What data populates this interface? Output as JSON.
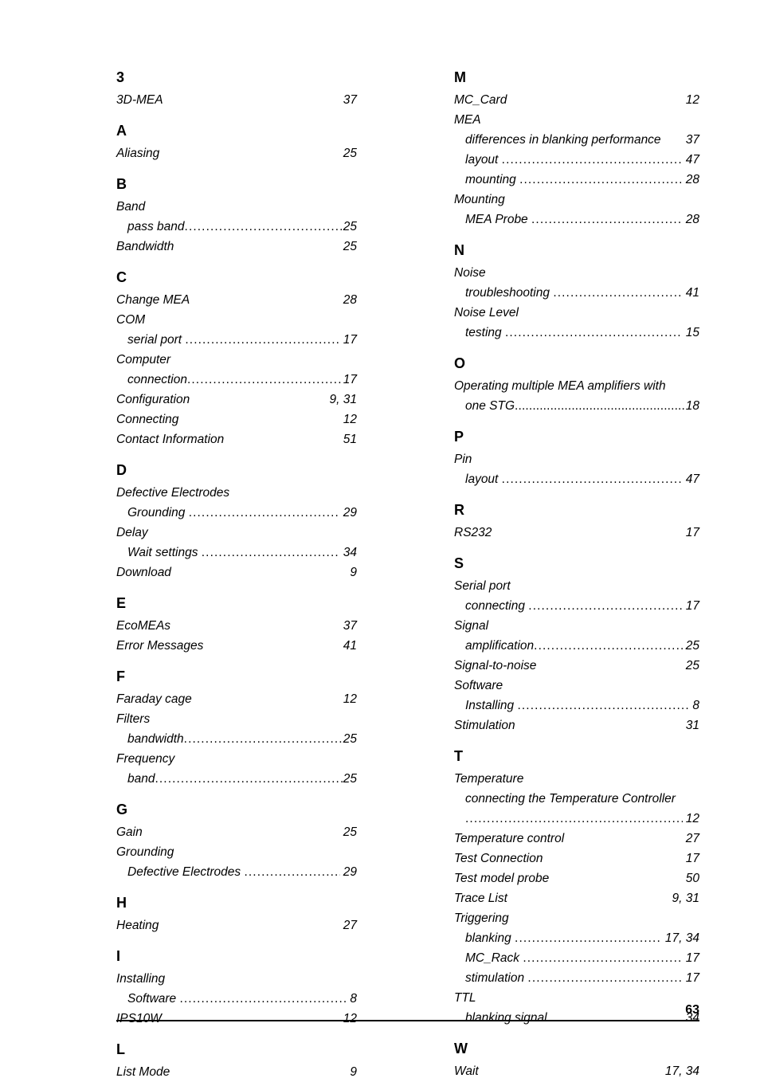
{
  "document": {
    "footer_page_number": "63"
  },
  "index": {
    "left_column": [
      {
        "letter": "3",
        "entries": [
          {
            "kind": "entry",
            "label": "3D-MEA",
            "page": "37"
          }
        ]
      },
      {
        "letter": "A",
        "entries": [
          {
            "kind": "entry",
            "label": "Aliasing",
            "page": "25"
          }
        ]
      },
      {
        "letter": "B",
        "entries": [
          {
            "kind": "term",
            "label": "Band"
          },
          {
            "kind": "subentry",
            "label": "pass band",
            "page": "25",
            "leader": "normal",
            "gap": false
          },
          {
            "kind": "entry",
            "label": "Bandwidth",
            "page": "25"
          }
        ]
      },
      {
        "letter": "C",
        "entries": [
          {
            "kind": "entry",
            "label": "Change MEA",
            "page": "28"
          },
          {
            "kind": "term",
            "label": "COM"
          },
          {
            "kind": "subentry",
            "label": "serial port",
            "page": "17",
            "leader": "normal",
            "gap": true
          },
          {
            "kind": "term",
            "label": "Computer"
          },
          {
            "kind": "subentry",
            "label": "connection",
            "page": "17",
            "leader": "normal",
            "gap": false
          },
          {
            "kind": "entry",
            "label": "Configuration",
            "page": "9, 31"
          },
          {
            "kind": "entry",
            "label": "Connecting",
            "page": "12"
          },
          {
            "kind": "entry",
            "label": "Contact Information",
            "page": "51"
          }
        ]
      },
      {
        "letter": "D",
        "entries": [
          {
            "kind": "term",
            "label": "Defective Electrodes"
          },
          {
            "kind": "subentry",
            "label": "Grounding",
            "page": "29",
            "leader": "normal",
            "gap": true
          },
          {
            "kind": "term",
            "label": "Delay"
          },
          {
            "kind": "subentry",
            "label": "Wait settings",
            "page": "34",
            "leader": "normal",
            "gap": true
          },
          {
            "kind": "entry",
            "label": "Download",
            "page": "9"
          }
        ]
      },
      {
        "letter": "E",
        "entries": [
          {
            "kind": "entry",
            "label": "EcoMEAs",
            "page": "37"
          },
          {
            "kind": "entry",
            "label": "Error Messages",
            "page": "41"
          }
        ]
      },
      {
        "letter": "F",
        "entries": [
          {
            "kind": "entry",
            "label": "Faraday cage",
            "page": "12"
          },
          {
            "kind": "term",
            "label": "Filters"
          },
          {
            "kind": "subentry",
            "label": "bandwidth",
            "page": "25",
            "leader": "normal",
            "gap": false
          },
          {
            "kind": "term",
            "label": "Frequency"
          },
          {
            "kind": "subentry",
            "label": "band",
            "page": "25",
            "leader": "normal",
            "gap": false
          }
        ]
      },
      {
        "letter": "G",
        "entries": [
          {
            "kind": "entry",
            "label": "Gain",
            "page": "25"
          },
          {
            "kind": "term",
            "label": "Grounding"
          },
          {
            "kind": "subentry",
            "label": "Defective Electrodes",
            "page": "29",
            "leader": "normal",
            "gap": true
          }
        ]
      },
      {
        "letter": "H",
        "entries": [
          {
            "kind": "entry",
            "label": "Heating",
            "page": "27"
          }
        ]
      },
      {
        "letter": "I",
        "entries": [
          {
            "kind": "term",
            "label": "Installing"
          },
          {
            "kind": "subentry",
            "label": "Software",
            "page": "8",
            "leader": "normal",
            "gap": true
          },
          {
            "kind": "entry",
            "label": "IPS10W",
            "page": "12"
          }
        ]
      },
      {
        "letter": "L",
        "entries": [
          {
            "kind": "entry",
            "label": "List Mode",
            "page": "9"
          }
        ]
      }
    ],
    "right_column": [
      {
        "letter": "M",
        "entries": [
          {
            "kind": "entry",
            "label": "MC_Card",
            "page": "12"
          },
          {
            "kind": "term",
            "label": "MEA"
          },
          {
            "kind": "subentry-nolead",
            "label": "differences in blanking performance",
            "page": "37"
          },
          {
            "kind": "subentry",
            "label": "layout",
            "page": "47",
            "leader": "normal",
            "gap": true
          },
          {
            "kind": "subentry",
            "label": "mounting",
            "page": "28",
            "leader": "normal",
            "gap": true
          },
          {
            "kind": "term",
            "label": "Mounting"
          },
          {
            "kind": "subentry",
            "label": "MEA Probe",
            "page": "28",
            "leader": "normal",
            "gap": true
          }
        ]
      },
      {
        "letter": "N",
        "entries": [
          {
            "kind": "term",
            "label": "Noise"
          },
          {
            "kind": "subentry",
            "label": "troubleshooting",
            "page": "41",
            "leader": "normal",
            "gap": true
          },
          {
            "kind": "term",
            "label": "Noise Level"
          },
          {
            "kind": "subentry",
            "label": "testing",
            "page": "15",
            "leader": "normal",
            "gap": true
          }
        ]
      },
      {
        "letter": "O",
        "entries": [
          {
            "kind": "entry-wrap",
            "line1": "Operating multiple MEA amplifiers with",
            "line2": "one STG",
            "page": "18",
            "leader": "tight"
          }
        ]
      },
      {
        "letter": "P",
        "entries": [
          {
            "kind": "term",
            "label": "Pin"
          },
          {
            "kind": "subentry",
            "label": "layout",
            "page": "47",
            "leader": "normal",
            "gap": true
          }
        ]
      },
      {
        "letter": "R",
        "entries": [
          {
            "kind": "entry",
            "label": "RS232",
            "page": "17"
          }
        ]
      },
      {
        "letter": "S",
        "entries": [
          {
            "kind": "term",
            "label": "Serial port"
          },
          {
            "kind": "subentry",
            "label": "connecting",
            "page": "17",
            "leader": "normal",
            "gap": true
          },
          {
            "kind": "term",
            "label": "Signal"
          },
          {
            "kind": "subentry",
            "label": "amplification",
            "page": "25",
            "leader": "normal",
            "gap": false
          },
          {
            "kind": "entry",
            "label": "Signal-to-noise",
            "page": "25"
          },
          {
            "kind": "term",
            "label": "Software"
          },
          {
            "kind": "subentry",
            "label": "Installing",
            "page": "8",
            "leader": "normal",
            "gap": true
          },
          {
            "kind": "entry",
            "label": "Stimulation",
            "page": "31"
          }
        ]
      },
      {
        "letter": "T",
        "entries": [
          {
            "kind": "term",
            "label": "Temperature"
          },
          {
            "kind": "subentry-wrap",
            "line1": "connecting the Temperature Controller",
            "page": "12"
          },
          {
            "kind": "entry",
            "label": "Temperature control",
            "page": "27"
          },
          {
            "kind": "entry",
            "label": "Test Connection",
            "page": "17"
          },
          {
            "kind": "entry",
            "label": "Test model probe",
            "page": "50"
          },
          {
            "kind": "entry",
            "label": "Trace List",
            "page": "9, 31"
          },
          {
            "kind": "term",
            "label": "Triggering"
          },
          {
            "kind": "subentry",
            "label": "blanking",
            "page": "17, 34",
            "leader": "normal",
            "gap": true
          },
          {
            "kind": "subentry",
            "label": "MC_Rack",
            "page": "17",
            "leader": "normal",
            "gap": true
          },
          {
            "kind": "subentry",
            "label": "stimulation",
            "page": "17",
            "leader": "normal",
            "gap": true
          },
          {
            "kind": "term",
            "label": "TTL"
          },
          {
            "kind": "subentry",
            "label": "blanking signal",
            "page": "34",
            "leader": "normal",
            "gap": true
          }
        ]
      },
      {
        "letter": "W",
        "entries": [
          {
            "kind": "entry",
            "label": "Wait",
            "page": "17, 34"
          }
        ]
      }
    ]
  }
}
